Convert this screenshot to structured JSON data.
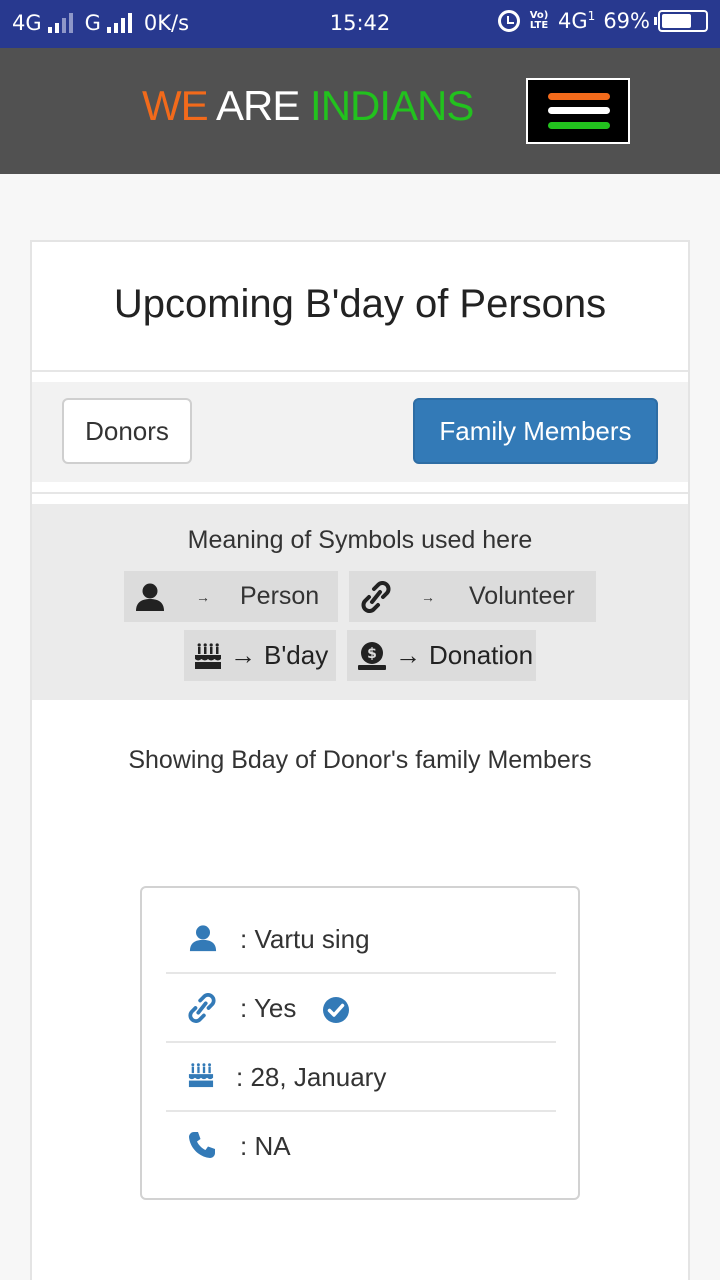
{
  "status_bar": {
    "network1": "4G",
    "network2": "G",
    "speed": "0K/s",
    "time": "15:42",
    "volte": "Vo) LTE",
    "network3": "4G",
    "sim": "1",
    "battery": "69%",
    "battery_level": 0.69
  },
  "header": {
    "brand_word1": "WE",
    "brand_word2": "ARE",
    "brand_word3": "INDIANS",
    "brand_colors": {
      "word1": "#f26a1b",
      "word2": "#ffffff",
      "word3": "#22c21e"
    },
    "menu_icon": "hamburger-icon"
  },
  "card": {
    "title": "Upcoming B'day of Persons",
    "tabs": {
      "donors_label": "Donors",
      "family_label": "Family Members",
      "active": "Family Members",
      "active_color": "#337ab7"
    },
    "legend": {
      "title": "Meaning of Symbols used here",
      "items": [
        {
          "icon": "person-icon",
          "arrow": "→",
          "label": "Person"
        },
        {
          "icon": "link-icon",
          "arrow": "→",
          "label": "Volunteer"
        },
        {
          "icon": "birthday-cake-icon",
          "arrow": "→",
          "label": "B'day"
        },
        {
          "icon": "money-bag-icon",
          "arrow": "→",
          "label": "Donation"
        }
      ]
    },
    "showing_text": "Showing Bday of Donor's family Members",
    "member": {
      "name": ": Vartu sing",
      "volunteer": ": Yes",
      "birthday": ": 28, January",
      "phone": ": NA",
      "icon_color": "#337ab7"
    }
  }
}
